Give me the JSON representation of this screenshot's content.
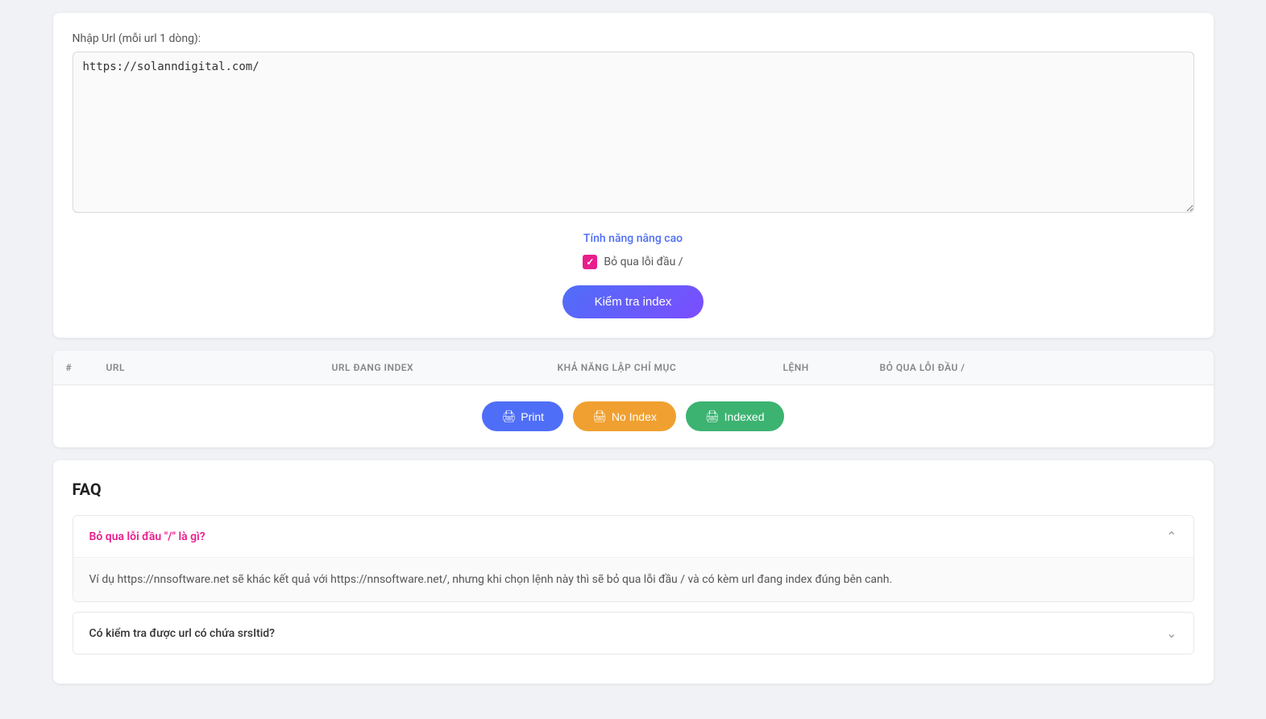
{
  "input_section": {
    "label": "Nhập Url (mỗi url 1 dòng):",
    "textarea_value": "https://solanndigital.com/",
    "textarea_placeholder": "https://solanndigital.com/"
  },
  "advanced": {
    "title": "Tính năng nâng cao",
    "checkbox_label": "Bỏ qua lỗi đầu /",
    "checkbox_checked": true
  },
  "check_button": {
    "label": "Kiểm tra index"
  },
  "table": {
    "columns": [
      "#",
      "URL",
      "URL ĐANG INDEX",
      "KHẢ NĂNG LẬP CHỈ MỤC",
      "LỆNH",
      "BỎ QUA LỖI ĐẦU /"
    ],
    "rows": [],
    "actions": {
      "print_label": "Print",
      "noindex_label": "No Index",
      "indexed_label": "Indexed"
    }
  },
  "faq": {
    "title": "FAQ",
    "items": [
      {
        "question": "Bỏ qua lỗi đầu \"/\" là gì?",
        "answer": "Ví dụ https://nnsoftware.net sẽ khác kết quả với https://nnsoftware.net/, nhưng khi chọn lệnh này thì sẽ bỏ qua lỗi đầu / và có kèm url đang index đúng bên canh.",
        "open": true
      },
      {
        "question": "Có kiểm tra được url có chứa srsItid?",
        "answer": "",
        "open": false
      }
    ]
  }
}
